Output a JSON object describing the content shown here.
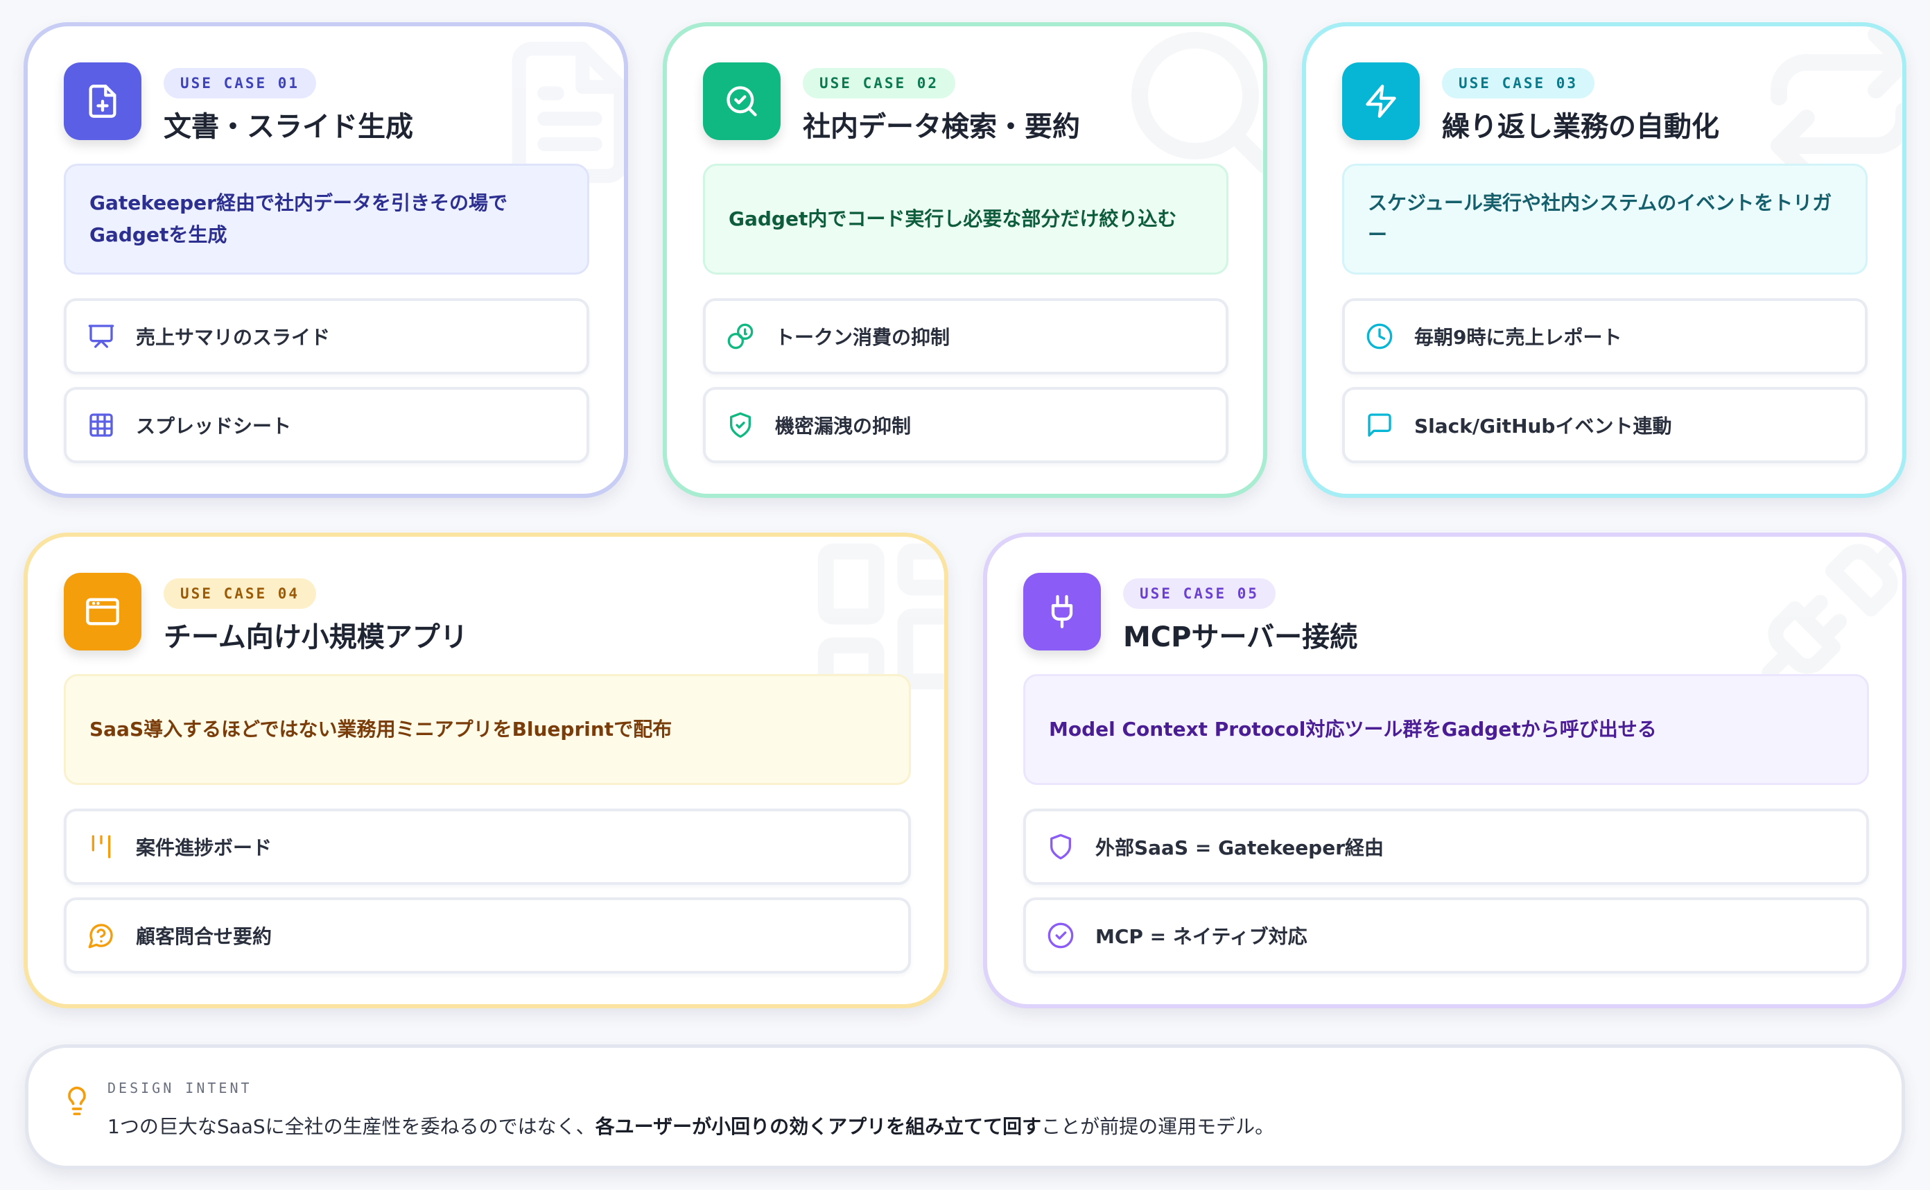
{
  "cards": [
    {
      "badge": "USE CASE 01",
      "title": "文書・スライド生成",
      "desc": "Gatekeeper経由で社内データを引きその場でGadgetを生成",
      "items": [
        {
          "label": "売上サマリのスライド",
          "icon": "presentation-icon"
        },
        {
          "label": "スプレッドシート",
          "icon": "table-icon"
        }
      ],
      "icon": "file-plus-icon",
      "colors": {
        "accent": "#5b5fe6",
        "border": "#c7cdf5",
        "badge_bg": "#e6e9ff",
        "badge_fg": "#3f43b8",
        "desc_bg": "#eef1ff",
        "desc_fg": "#2c2f8f"
      }
    },
    {
      "badge": "USE CASE 02",
      "title": "社内データ検索・要約",
      "desc": "Gadget内でコード実行し必要な部分だけ絞り込む",
      "items": [
        {
          "label": "トークン消費の抑制",
          "icon": "coins-icon"
        },
        {
          "label": "機密漏洩の抑制",
          "icon": "shield-check-icon"
        }
      ],
      "icon": "search-check-icon",
      "colors": {
        "accent": "#10b981",
        "border": "#a8ecd1",
        "badge_bg": "#dcfce9",
        "badge_fg": "#0b7a52",
        "desc_bg": "#ecfdf4",
        "desc_fg": "#0d5c3c"
      }
    },
    {
      "badge": "USE CASE 03",
      "title": "繰り返し業務の自動化",
      "desc": "スケジュール実行や社内システムのイベントをトリガー",
      "items": [
        {
          "label": "毎朝9時に売上レポート",
          "icon": "clock-icon"
        },
        {
          "label": "Slack/GitHubイベント連動",
          "icon": "message-icon"
        }
      ],
      "icon": "zap-icon",
      "colors": {
        "accent": "#06b6d4",
        "border": "#a5eef5",
        "badge_bg": "#d6f7fb",
        "badge_fg": "#087a8c",
        "desc_bg": "#ecfcfd",
        "desc_fg": "#155e6b"
      }
    },
    {
      "badge": "USE CASE 04",
      "title": "チーム向け小規模アプリ",
      "desc": "SaaS導入するほどではない業務用ミニアプリをBlueprintで配布",
      "items": [
        {
          "label": "案件進捗ボード",
          "icon": "kanban-icon"
        },
        {
          "label": "顧客問合せ要約",
          "icon": "help-circle-icon"
        }
      ],
      "icon": "app-window-icon",
      "colors": {
        "accent": "#f59e0b",
        "border": "#fbe3a1",
        "badge_bg": "#fdf0c8",
        "badge_fg": "#9a5a06",
        "desc_bg": "#fefbe9",
        "desc_fg": "#7a3d0a"
      }
    },
    {
      "badge": "USE CASE 05",
      "title": "MCPサーバー接続",
      "desc": "Model Context Protocol対応ツール群をGadgetから呼び出せる",
      "items": [
        {
          "label": "外部SaaS = Gatekeeper経由",
          "icon": "shield-icon"
        },
        {
          "label": "MCP = ネイティブ対応",
          "icon": "check-circle-icon"
        }
      ],
      "icon": "plug-icon",
      "colors": {
        "accent": "#8b5cf6",
        "border": "#ddd3fb",
        "badge_bg": "#efe9fe",
        "badge_fg": "#6b3fd0",
        "desc_bg": "#f5f3ff",
        "desc_fg": "#4b1d95"
      }
    }
  ],
  "footer": {
    "kicker": "DESIGN INTENT",
    "text_pre": "1つの巨大なSaaSに全社の生産性を委ねるのではなく、",
    "text_bold": "各ユーザーが小回りの効くアプリを組み立てて回す",
    "text_post": "ことが前提の運用モデル。",
    "icon": "lightbulb-icon",
    "icon_color": "#f59e0b"
  }
}
